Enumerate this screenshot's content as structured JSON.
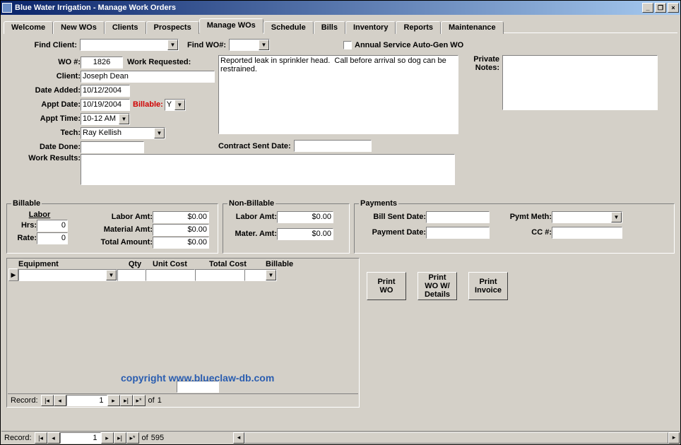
{
  "window": {
    "title": "Blue Water Irrigation - Manage Work Orders",
    "min": "_",
    "restore": "❐",
    "close": "×"
  },
  "tabs": [
    "Welcome",
    "New WOs",
    "Clients",
    "Prospects",
    "Manage WOs",
    "Schedule",
    "Bills",
    "Inventory",
    "Reports",
    "Maintenance"
  ],
  "active_tab_index": 4,
  "top": {
    "find_client_label": "Find Client:",
    "find_client_value": "",
    "find_wo_label": "Find WO#:",
    "find_wo_value": "",
    "annual_label": "Annual Service Auto-Gen WO"
  },
  "left": {
    "wo_num_label": "WO #:",
    "wo_num": "1826",
    "client_label": "Client:",
    "client": "Joseph Dean",
    "date_added_label": "Date Added:",
    "date_added": "10/12/2004",
    "appt_date_label": "Appt Date:",
    "appt_date": "10/19/2004",
    "billable_label": "Billable:",
    "billable": "Y",
    "appt_time_label": "Appt Time:",
    "appt_time": "10-12 AM",
    "tech_label": "Tech:",
    "tech": "Ray Kellish",
    "date_done_label": "Date Done:",
    "date_done": "",
    "work_results_label": "Work Results:",
    "work_results": "",
    "work_req_label": "Work Requested:",
    "work_req": "Reported leak in sprinkler head.  Call before arrival so dog can be restrained.",
    "contract_sent_label": "Contract Sent Date:",
    "contract_sent": "",
    "private_notes_label": "Private Notes:",
    "private_notes": ""
  },
  "billable": {
    "legend": "Billable",
    "labor_header": "Labor",
    "hrs_label": "Hrs:",
    "hrs": "0",
    "rate_label": "Rate:",
    "rate": "0",
    "labor_amt_label": "Labor Amt:",
    "labor_amt": "$0.00",
    "material_amt_label": "Material Amt:",
    "material_amt": "$0.00",
    "total_amt_label": "Total Amount:",
    "total_amt": "$0.00"
  },
  "nonbillable": {
    "legend": "Non-Billable",
    "labor_amt_label": "Labor Amt:",
    "labor_amt": "$0.00",
    "mater_amt_label": "Mater. Amt:",
    "mater_amt": "$0.00"
  },
  "payments": {
    "legend": "Payments",
    "bill_sent_label": "Bill Sent Date:",
    "bill_sent": "",
    "payment_date_label": "Payment Date:",
    "payment_date": "",
    "pymt_meth_label": "Pymt Meth:",
    "pymt_meth": "",
    "cc_label": "CC #:",
    "cc": ""
  },
  "grid": {
    "headers": [
      "Equipment",
      "Qty",
      "Unit Cost",
      "Total Cost",
      "Billable"
    ],
    "row": {
      "equipment": "",
      "qty": "",
      "unit_cost": "",
      "total_cost": "",
      "billable": ""
    }
  },
  "buttons": {
    "print_wo": "Print\nWO",
    "print_wo_details": "Print\nWO W/\nDetails",
    "print_invoice": "Print\nInvoice"
  },
  "watermark": "copyright www.blueclaw-db.com",
  "nav_inner": {
    "label": "Record:",
    "pos": "1",
    "of_label": "of",
    "of": "1"
  },
  "nav_outer": {
    "label": "Record:",
    "pos": "1",
    "of_label": "of",
    "of": "595"
  }
}
